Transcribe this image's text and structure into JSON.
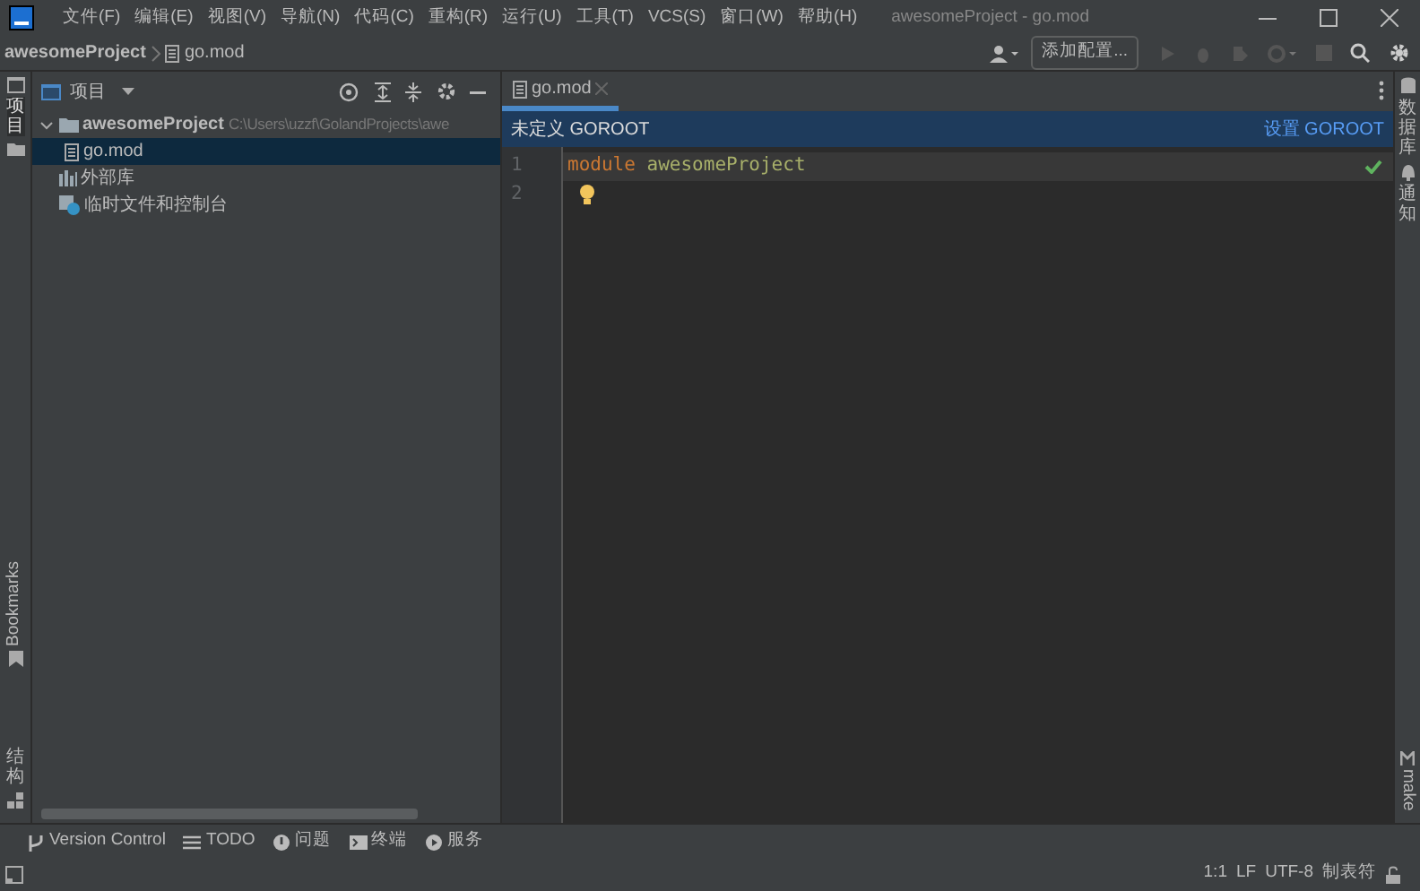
{
  "window": {
    "title": "awesomeProject - go.mod"
  },
  "menu": [
    {
      "label": "文件(F)"
    },
    {
      "label": "编辑(E)"
    },
    {
      "label": "视图(V)"
    },
    {
      "label": "导航(N)"
    },
    {
      "label": "代码(C)"
    },
    {
      "label": "重构(R)"
    },
    {
      "label": "运行(U)"
    },
    {
      "label": "工具(T)"
    },
    {
      "label": "VCS(S)"
    },
    {
      "label": "窗口(W)"
    },
    {
      "label": "帮助(H)"
    }
  ],
  "breadcrumbs": [
    "awesomeProject",
    "go.mod"
  ],
  "toolbar": {
    "add_config": "添加配置..."
  },
  "left_stripe": [
    {
      "label": "项目",
      "kind": "cjk",
      "selected": true
    },
    {
      "label": "Bookmarks",
      "kind": "latin",
      "selected": false
    },
    {
      "label": "结构",
      "kind": "cjk",
      "selected": false
    }
  ],
  "project_panel": {
    "title": "项目",
    "tree": [
      {
        "label": "awesomeProject",
        "path": "C:\\Users\\uzzf\\GolandProjects\\awe",
        "kind": "folder",
        "expanded": true,
        "selected": false,
        "children": [
          {
            "label": "go.mod",
            "kind": "file",
            "selected": true
          }
        ]
      },
      {
        "label": "外部库",
        "kind": "library",
        "selected": false
      },
      {
        "label": "临时文件和控制台",
        "kind": "scratch",
        "selected": false
      }
    ]
  },
  "editor": {
    "tabs": [
      {
        "label": "go.mod",
        "selected": true
      }
    ],
    "banner": {
      "message": "未定义 GOROOT",
      "action": "设置 GOROOT"
    },
    "lines": [
      {
        "number": "1",
        "current": true,
        "tokens": [
          {
            "text": "module",
            "kind": "keyword"
          },
          {
            "text": " awesomeProject",
            "kind": "name"
          }
        ]
      },
      {
        "number": "2",
        "current": false
      }
    ]
  },
  "right_stripe": [
    {
      "label": "数据库",
      "kind": "cjk"
    },
    {
      "label": "通知",
      "kind": "cjk"
    },
    {
      "label": "make",
      "kind": "latin"
    }
  ],
  "bottom_tools": [
    {
      "label": "Version Control",
      "kind": "vcs"
    },
    {
      "label": "TODO",
      "kind": "todo"
    },
    {
      "label": "问题",
      "kind": "problems"
    },
    {
      "label": "终端",
      "kind": "terminal"
    },
    {
      "label": "服务",
      "kind": "services"
    }
  ],
  "status_bar": [
    "1:1",
    "LF",
    "UTF-8",
    "制表符"
  ]
}
